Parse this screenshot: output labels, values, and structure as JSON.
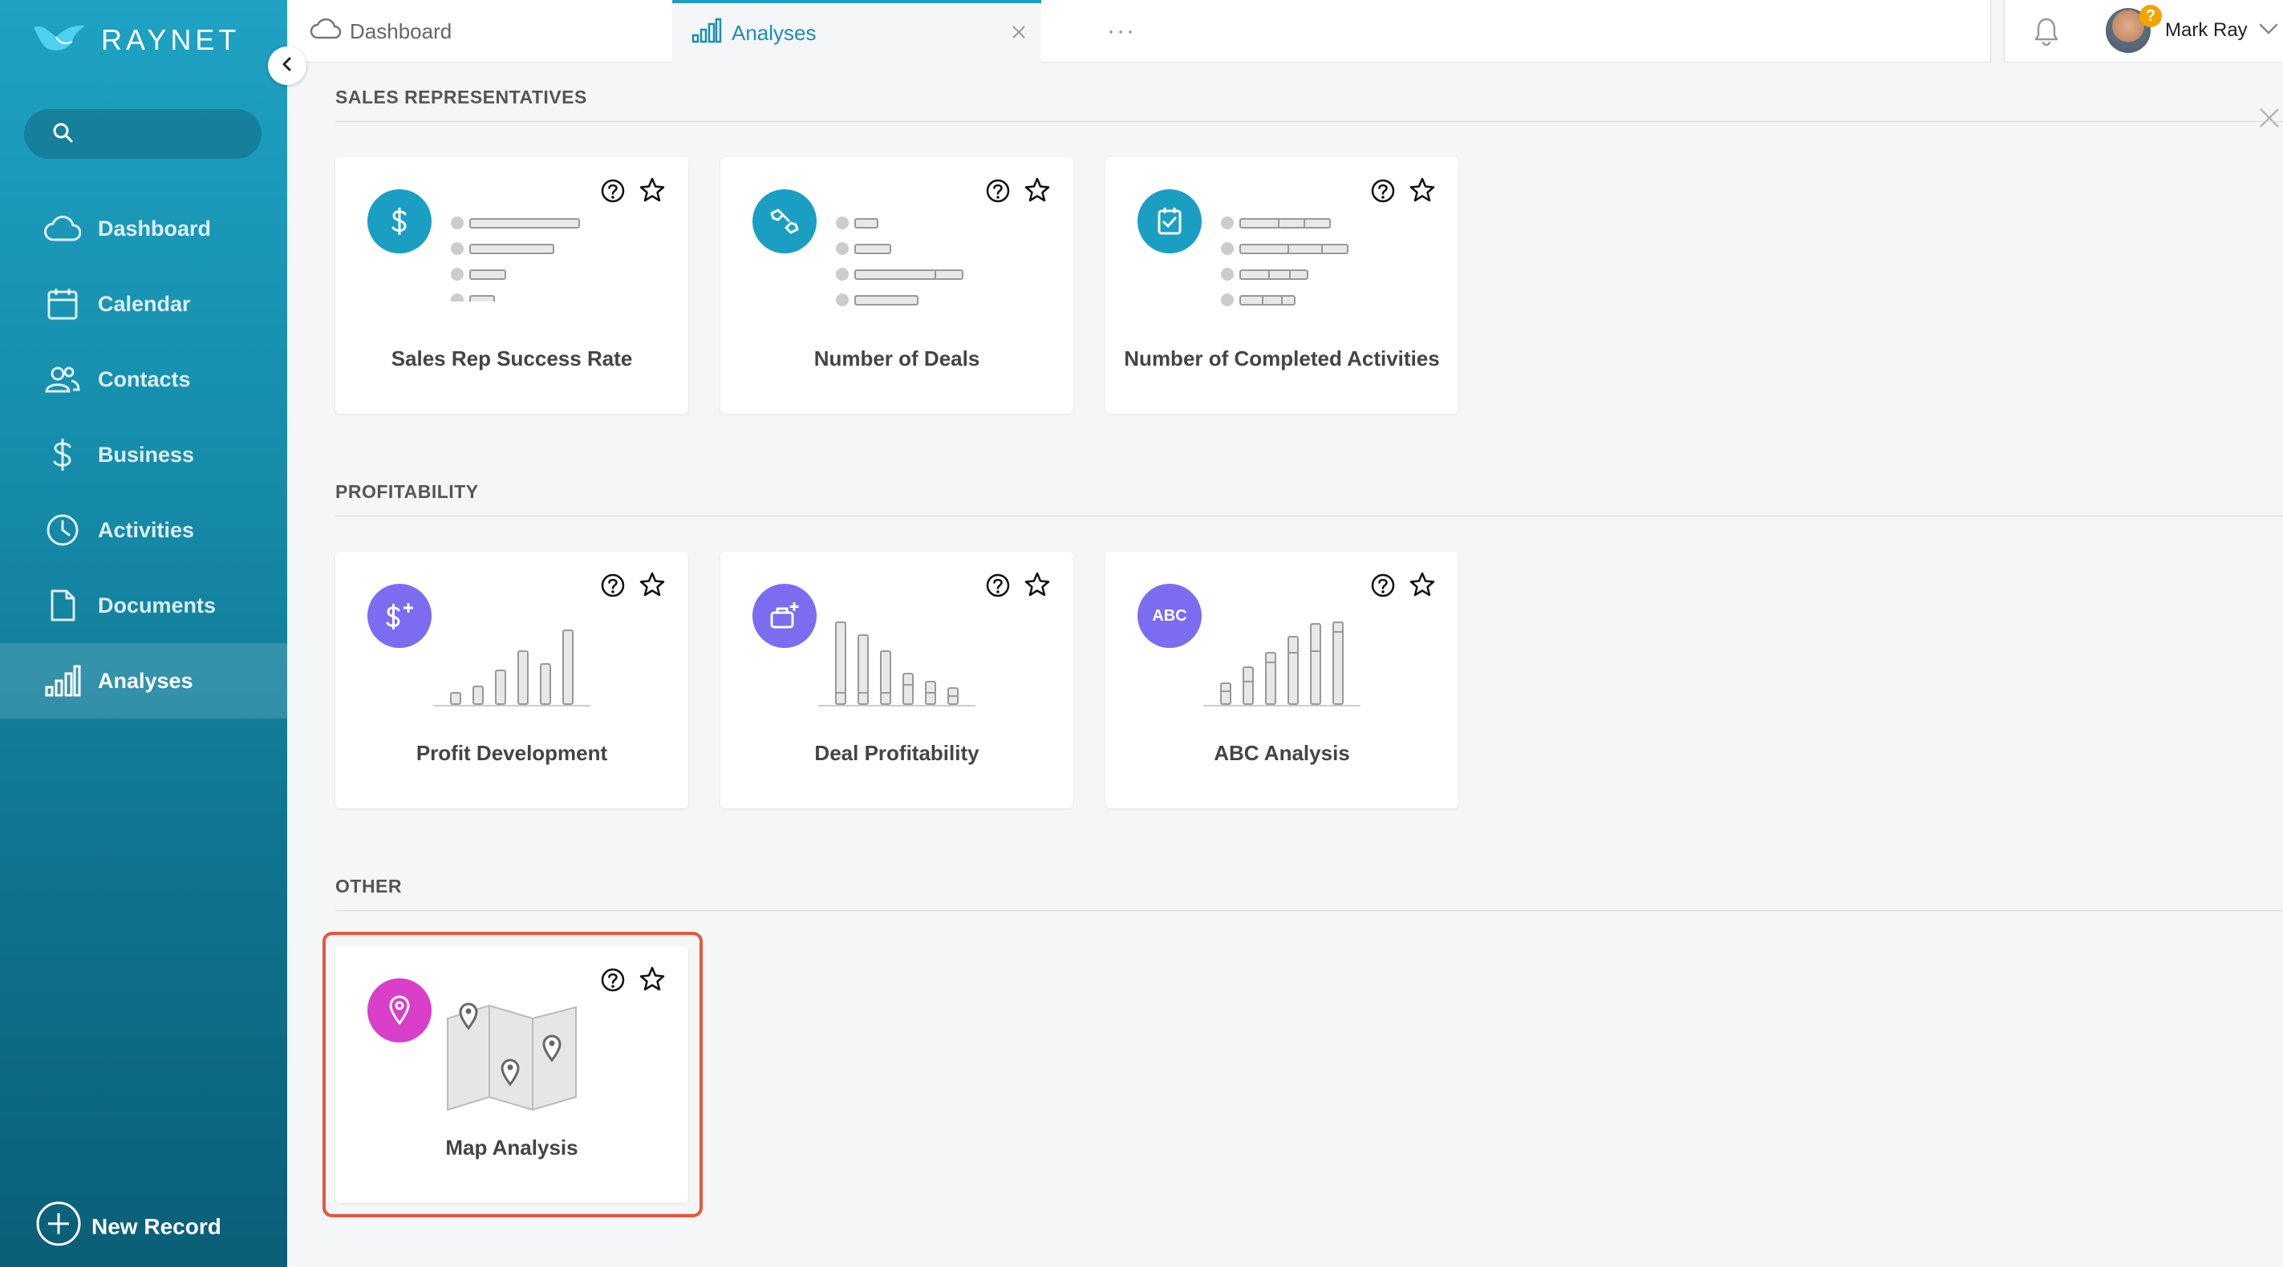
{
  "app": {
    "brand": "RAYNET",
    "accent": "#1a9fc2"
  },
  "sidebar": {
    "search_placeholder": "",
    "items": [
      {
        "label": "Dashboard",
        "icon": "cloud-icon"
      },
      {
        "label": "Calendar",
        "icon": "calendar-icon"
      },
      {
        "label": "Contacts",
        "icon": "contacts-icon"
      },
      {
        "label": "Business",
        "icon": "dollar-icon"
      },
      {
        "label": "Activities",
        "icon": "clock-icon"
      },
      {
        "label": "Documents",
        "icon": "document-icon"
      },
      {
        "label": "Analyses",
        "icon": "bar-chart-icon",
        "active": true
      }
    ],
    "new_record": "New Record"
  },
  "tabs": [
    {
      "label": "Dashboard",
      "icon": "cloud-icon"
    },
    {
      "label": "Analyses",
      "icon": "bar-chart-icon",
      "active": true
    }
  ],
  "more_label": "···",
  "user": {
    "name": "Mark Ray",
    "badge": "?"
  },
  "sections": [
    {
      "title": "SALES REPRESENTATIVES",
      "cards": [
        {
          "label": "Sales Rep Success Rate",
          "icon": "dollar-icon",
          "color": "#1a9fc2"
        },
        {
          "label": "Number of Deals",
          "icon": "handshake-icon",
          "color": "#1a9fc2"
        },
        {
          "label": "Number of Completed Activities",
          "icon": "checklist-icon",
          "color": "#1a9fc2"
        }
      ]
    },
    {
      "title": "PROFITABILITY",
      "cards": [
        {
          "label": "Profit Development",
          "icon": "dollar-plus-icon",
          "color": "#7b6cf0"
        },
        {
          "label": "Deal Profitability",
          "icon": "briefcase-plus-icon",
          "color": "#7b6cf0"
        },
        {
          "label": "ABC Analysis",
          "icon": "abc-icon",
          "icon_text": "ABC",
          "color": "#7b6cf0"
        }
      ]
    },
    {
      "title": "OTHER",
      "cards": [
        {
          "label": "Map Analysis",
          "icon": "map-pin-icon",
          "color": "#d93fc8",
          "highlighted": true
        }
      ]
    }
  ]
}
